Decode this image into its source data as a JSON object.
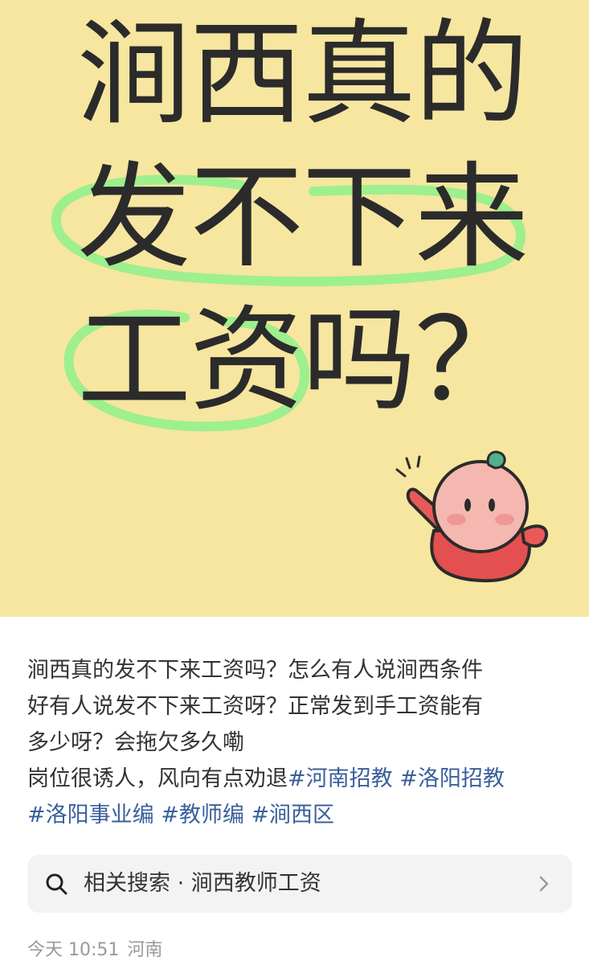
{
  "cover": {
    "background_color": "#f6e6a0",
    "title_lines": [
      "涧西真的",
      "发不下来",
      "工资吗？"
    ],
    "highlight_color": "#8ef08a",
    "mascot": "waving-pink-mascot-with-leaf"
  },
  "post": {
    "lines": [
      "涧西真的发不下来工资吗？怎么有人说涧西条件",
      "好有人说发不下来工资呀？正常发到手工资能有",
      "多少呀？会拖欠多久嘞"
    ],
    "line4_text": "岗位很诱人，风向有点劝退",
    "tags": [
      "#河南招教",
      "#洛阳招教",
      "#洛阳事业编",
      "#教师编",
      "#涧西区"
    ]
  },
  "related_search": {
    "icon": "search-icon",
    "label": "相关搜索 · 涧西教师工资",
    "chevron": "chevron-right-icon"
  },
  "meta": {
    "date": "今天 10:51",
    "location": "河南"
  },
  "colors": {
    "tag": "#3a5f9a",
    "text": "#333333",
    "meta": "#999999"
  }
}
